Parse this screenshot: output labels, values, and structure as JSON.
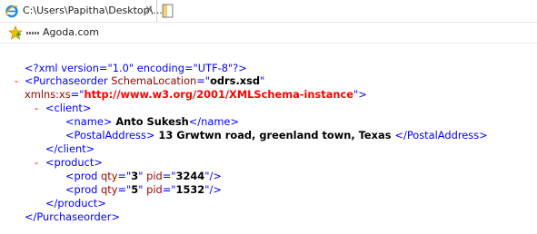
{
  "tab": {
    "title": "C:\\Users\\Papitha\\Desktop\\...",
    "close_glyph": "×"
  },
  "favorites": {
    "item_label": "Agoda.com"
  },
  "xml": {
    "toggle_glyph": "-",
    "decl": "<?xml version=\"1.0\" encoding=\"UTF-8\"?>",
    "root_open_start": "<Purchaseorder",
    "attr_schema_name": "SchemaLocation",
    "eq_quote": "=\"",
    "schema_value": "odrs.xsd",
    "close_quote": "\"",
    "attr_xmlns_name": "xmlns:xs",
    "xmlns_value": "http://www.w3.org/2001/XMLSchema-instance",
    "close_quote_gt": "\">",
    "client_open": "<client>",
    "name_open": "<name>",
    "name_value": " Anto Sukesh",
    "name_close": "</name>",
    "postal_open": "<PostalAddress>",
    "postal_value": " 13 Grwtwn road, greenland town, Texas ",
    "postal_close": "</PostalAddress>",
    "client_close": "</client>",
    "product_open": "<product>",
    "prod_start": "<prod",
    "attr_qty": "qty",
    "attr_pid": "pid",
    "self_close": "/>",
    "prods": [
      {
        "qty": "3",
        "pid": "3244"
      },
      {
        "qty": "5",
        "pid": "1532"
      }
    ],
    "product_close": "</product>",
    "root_close": "</Purchaseorder>"
  },
  "colors": {
    "tag": "#0000ff",
    "attr_name": "#990000",
    "attr_value": "#000000",
    "url_value": "#ff0000",
    "toggle": "#ff0000"
  },
  "icons": {
    "tab_icon": "ie-icon",
    "new_tab": "new-tab-icon",
    "favorite": "favorites-star-icon",
    "site": "site-favicon"
  }
}
